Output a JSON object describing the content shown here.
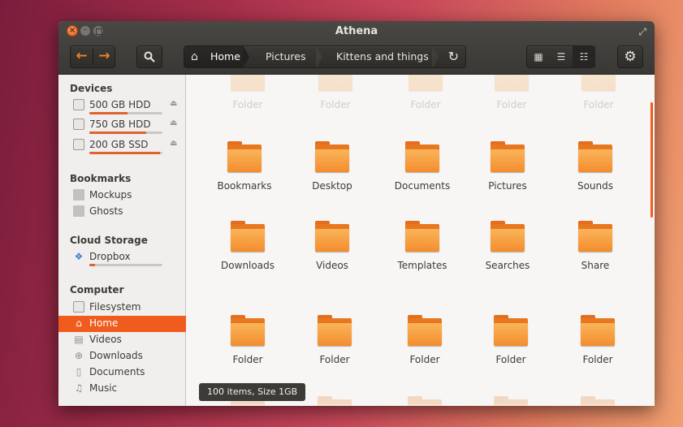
{
  "window": {
    "title": "Athena",
    "controls": {
      "close": "×",
      "minimize": "–"
    }
  },
  "toolbar": {
    "back_icon": "arrow-left",
    "forward_icon": "arrow-right",
    "search_icon": "magnifier",
    "breadcrumbs": [
      "Home",
      "Pictures",
      "Kittens and things"
    ],
    "refresh_icon": "refresh",
    "view_modes": [
      "icon-view",
      "list-view",
      "compact-view"
    ],
    "active_view": "compact-view",
    "settings_icon": "gear"
  },
  "sidebar": {
    "devices_title": "Devices",
    "devices": [
      {
        "label": "500 GB HDD",
        "usage": 0.52
      },
      {
        "label": "750 GB HDD",
        "usage": 0.78
      },
      {
        "label": "200 GB SSD",
        "usage": 0.97
      }
    ],
    "bookmarks_title": "Bookmarks",
    "bookmarks": [
      "Mockups",
      "Ghosts"
    ],
    "cloud_title": "Cloud Storage",
    "cloud": [
      {
        "label": "Dropbox",
        "usage": 0.08
      }
    ],
    "computer_title": "Computer",
    "computer": [
      "Filesystem",
      "Home",
      "Videos",
      "Downloads",
      "Documents",
      "Music"
    ],
    "selected": "Home"
  },
  "content": {
    "top_row": [
      "Folder",
      "Folder",
      "Folder",
      "Folder",
      "Folder"
    ],
    "row1": [
      "Bookmarks",
      "Desktop",
      "Documents",
      "Pictures",
      "Sounds"
    ],
    "row2": [
      "Downloads",
      "Videos",
      "Templates",
      "Searches",
      "Share"
    ],
    "row3": [
      "Folder",
      "Folder",
      "Folder",
      "Folder",
      "Folder"
    ],
    "accent": "#f05b1e",
    "folder_color": "#f38d2e"
  },
  "status": "100 items, Size 1GB"
}
